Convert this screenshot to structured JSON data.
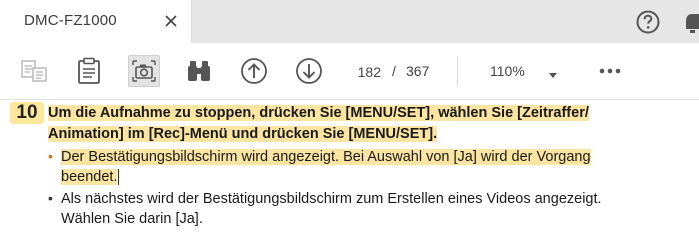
{
  "tab": {
    "title": "DMC-FZ1000"
  },
  "toolbar": {
    "page_current": "182",
    "page_separator": "/",
    "page_total": "367",
    "zoom": "110%"
  },
  "content": {
    "step_number": "10",
    "heading_line1": "Um die Aufnahme zu stoppen, drücken Sie [MENU/SET], wählen Sie [Zeitraffer/",
    "heading_line2": "Animation] im [Rec]-Menü und drücken Sie [MENU/SET].",
    "bullet1_line1": "Der Bestätigungsbildschirm wird angezeigt. Bei Auswahl von [Ja] wird der Vorgang",
    "bullet1_line2": "beendet.",
    "bullet2_line1": "Als nächstes wird der Bestätigungsbildschirm zum Erstellen eines Videos angezeigt.",
    "bullet2_line2": "Wählen Sie darin [Ja].",
    "bullet_char": "•"
  },
  "colors": {
    "highlight": "#fbe5a0",
    "step_badge": "#ffe899",
    "tab_bar": "#e6e6e6"
  }
}
